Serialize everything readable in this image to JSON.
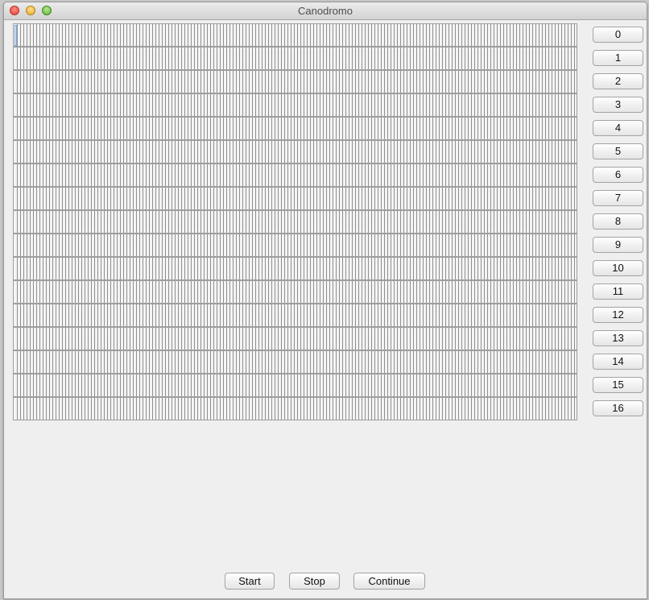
{
  "window": {
    "title": "Canodromo"
  },
  "tracks": {
    "count": 17
  },
  "lane_buttons": [
    "0",
    "1",
    "2",
    "3",
    "4",
    "5",
    "6",
    "7",
    "8",
    "9",
    "10",
    "11",
    "12",
    "13",
    "14",
    "15",
    "16"
  ],
  "controls": {
    "start_label": "Start",
    "stop_label": "Stop",
    "continue_label": "Continue"
  }
}
